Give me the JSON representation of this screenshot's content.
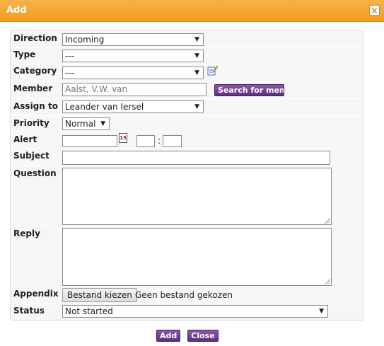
{
  "dialog": {
    "title": "Add",
    "close_glyph": "×"
  },
  "form": {
    "direction": {
      "label": "Direction",
      "value": "Incoming"
    },
    "type": {
      "label": "Type",
      "value": "---"
    },
    "category": {
      "label": "Category",
      "value": "---",
      "edit_icon": "edit-note-icon"
    },
    "member": {
      "label": "Member",
      "value": "Aalst, V.W. van",
      "search_button": "Search for memb"
    },
    "assign_to": {
      "label": "Assign to",
      "value": "Leander van Iersel"
    },
    "priority": {
      "label": "Priority",
      "value": "Normal"
    },
    "alert": {
      "label": "Alert",
      "date_value": "",
      "calendar_icon": "calendar-icon",
      "calendar_glyph": "15",
      "hour": "",
      "separator": ":",
      "minute": ""
    },
    "subject": {
      "label": "Subject",
      "value": ""
    },
    "question": {
      "label": "Question",
      "value": ""
    },
    "reply": {
      "label": "Reply",
      "value": ""
    },
    "appendix": {
      "label": "Appendix",
      "button": "Bestand kiezen",
      "status_text": "Geen bestand gekozen"
    },
    "status": {
      "label": "Status",
      "value": "Not started"
    }
  },
  "footer": {
    "add_label": "Add",
    "close_label": "Close"
  },
  "colors": {
    "title_bar": "#f39c1c",
    "button_purple": "#5e2f82"
  }
}
